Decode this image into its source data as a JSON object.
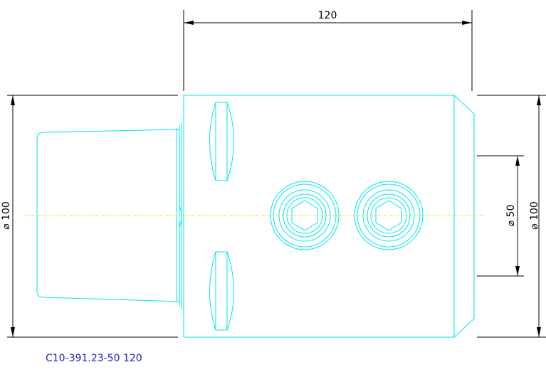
{
  "dimensions": {
    "length": "120",
    "left_diameter": "⌀ 100",
    "right_diameter": "⌀ 100",
    "bore_diameter": "⌀ 50"
  },
  "part_code": "C10-391.23-50 120",
  "colors": {
    "geometry": "#00e5ee",
    "dimension": "#000000",
    "centerline": "#e8e800",
    "part_code": "#2020c8"
  }
}
